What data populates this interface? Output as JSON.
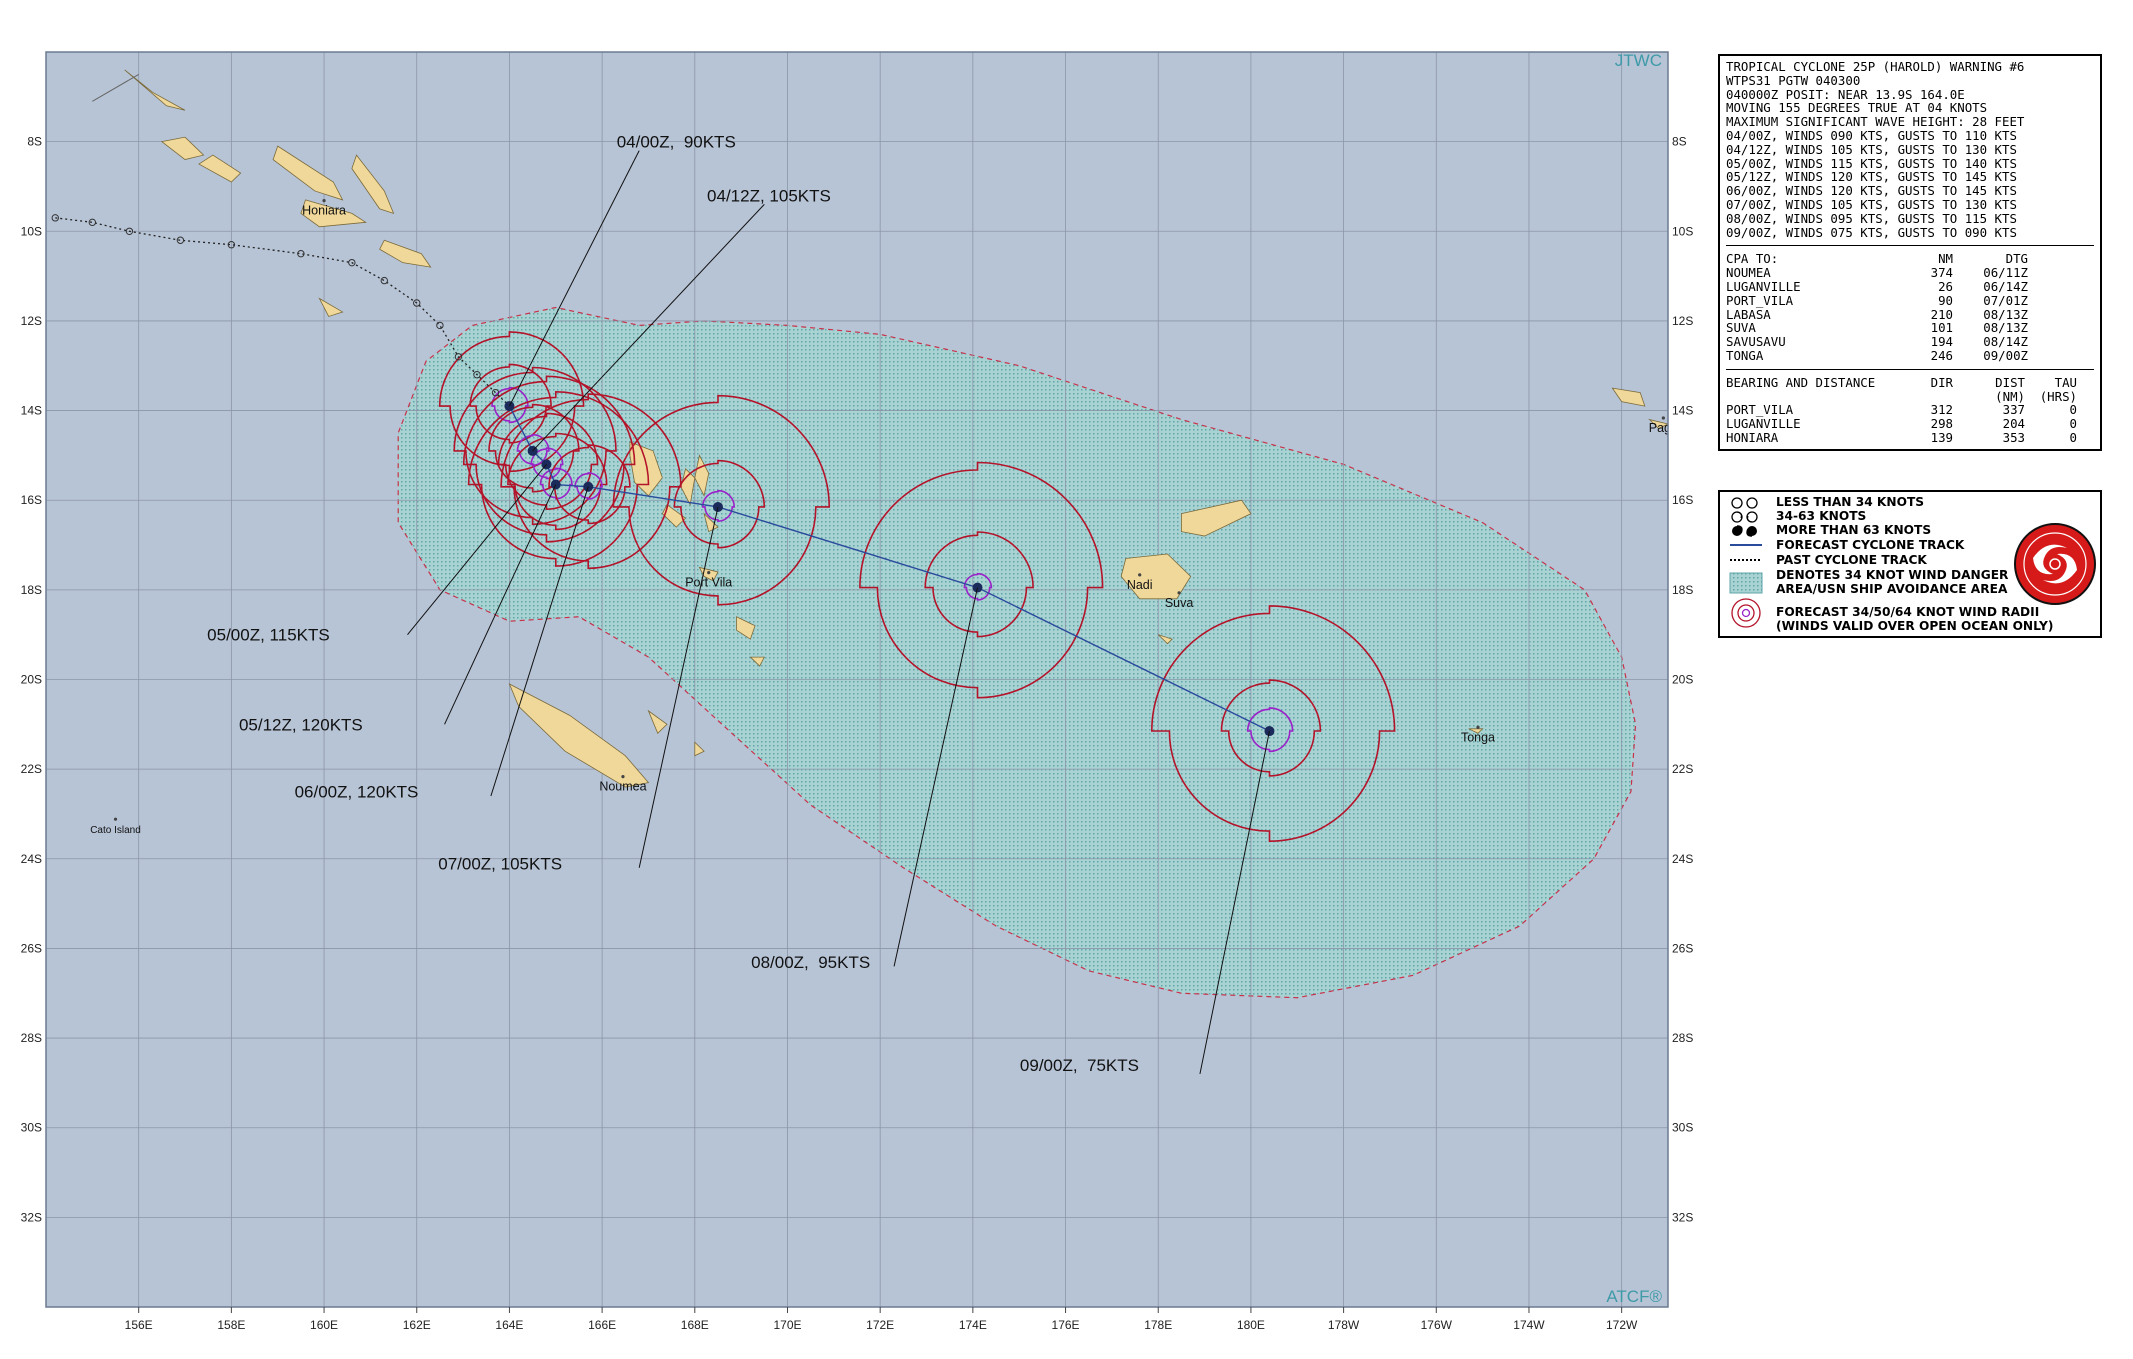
{
  "map": {
    "lon_range": [
      154.0,
      189.0
    ],
    "lat_range": [
      -34.0,
      -6.0
    ],
    "corner_labels": {
      "top_right": "JTWC",
      "bottom_right": "ATCF®"
    },
    "lat_ticks": [
      {
        "lat": -8,
        "label": "8S"
      },
      {
        "lat": -10,
        "label": "10S"
      },
      {
        "lat": -12,
        "label": "12S"
      },
      {
        "lat": -14,
        "label": "14S"
      },
      {
        "lat": -16,
        "label": "16S"
      },
      {
        "lat": -18,
        "label": "18S"
      },
      {
        "lat": -20,
        "label": "20S"
      },
      {
        "lat": -22,
        "label": "22S"
      },
      {
        "lat": -24,
        "label": "24S"
      },
      {
        "lat": -26,
        "label": "26S"
      },
      {
        "lat": -28,
        "label": "28S"
      },
      {
        "lat": -30,
        "label": "30S"
      },
      {
        "lat": -32,
        "label": "32S"
      }
    ],
    "lon_ticks": [
      {
        "lon": 156,
        "label": "156E"
      },
      {
        "lon": 158,
        "label": "158E"
      },
      {
        "lon": 160,
        "label": "160E"
      },
      {
        "lon": 162,
        "label": "162E"
      },
      {
        "lon": 164,
        "label": "164E"
      },
      {
        "lon": 166,
        "label": "166E"
      },
      {
        "lon": 168,
        "label": "168E"
      },
      {
        "lon": 170,
        "label": "170E"
      },
      {
        "lon": 172,
        "label": "172E"
      },
      {
        "lon": 174,
        "label": "174E"
      },
      {
        "lon": 176,
        "label": "176E"
      },
      {
        "lon": 178,
        "label": "178E"
      },
      {
        "lon": 180,
        "label": "180E"
      },
      {
        "lon": 182,
        "label": "178W"
      },
      {
        "lon": 184,
        "label": "176W"
      },
      {
        "lon": 186,
        "label": "174W"
      },
      {
        "lon": 188,
        "label": "172W"
      }
    ],
    "places": [
      {
        "name": "Honiara",
        "lon": 160.0,
        "lat": -9.45
      },
      {
        "name": "Port Vila",
        "lon": 168.3,
        "lat": -17.75
      },
      {
        "name": "Nadi",
        "lon": 177.6,
        "lat": -17.8
      },
      {
        "name": "Suva",
        "lon": 178.45,
        "lat": -18.2
      },
      {
        "name": "Noumea",
        "lon": 166.45,
        "lat": -22.3
      },
      {
        "name": "Cato Island",
        "lon": 155.5,
        "lat": -23.25
      },
      {
        "name": "Tonga",
        "lon": 184.9,
        "lat": -21.2
      },
      {
        "name": "Pago",
        "lon": 188.9,
        "lat": -14.3
      }
    ],
    "past_track": [
      [
        154.2,
        -9.7
      ],
      [
        155.0,
        -9.8
      ],
      [
        155.8,
        -10.0
      ],
      [
        156.9,
        -10.2
      ],
      [
        158.0,
        -10.3
      ],
      [
        159.5,
        -10.5
      ],
      [
        160.6,
        -10.7
      ],
      [
        161.3,
        -11.1
      ],
      [
        162.0,
        -11.6
      ],
      [
        162.5,
        -12.1
      ],
      [
        162.9,
        -12.8
      ],
      [
        163.3,
        -13.2
      ],
      [
        163.7,
        -13.6
      ],
      [
        164.0,
        -13.9
      ]
    ],
    "forecast_track": [
      [
        164.0,
        -13.9
      ],
      [
        164.5,
        -14.9
      ],
      [
        164.8,
        -15.2
      ],
      [
        165.0,
        -15.65
      ],
      [
        165.7,
        -15.7
      ],
      [
        168.5,
        -16.15
      ],
      [
        174.1,
        -17.95
      ],
      [
        180.4,
        -21.15
      ]
    ],
    "forecast_points": [
      {
        "label": "04/00Z,  90KTS",
        "lon": 164.0,
        "lat": -13.9,
        "r34": 1.6,
        "r50": 0.9,
        "r64": 0.4
      },
      {
        "label": "04/12Z, 105KTS",
        "lon": 164.5,
        "lat": -14.9,
        "r34": 1.8,
        "r50": 1.0,
        "r64": 0.35
      },
      {
        "label": "05/00Z, 115KTS",
        "lon": 164.8,
        "lat": -15.2,
        "r34": 1.9,
        "r50": 1.1,
        "r64": 0.35
      },
      {
        "label": "05/12Z, 120KTS",
        "lon": 165.0,
        "lat": -15.65,
        "r34": 2.0,
        "r50": 1.1,
        "r64": 0.35
      },
      {
        "label": "06/00Z, 120KTS",
        "lon": 165.7,
        "lat": -15.7,
        "r34": 2.0,
        "r50": 0.9,
        "r64": 0.3
      },
      {
        "label": "07/00Z, 105KTS",
        "lon": 168.5,
        "lat": -16.15,
        "r34": 2.4,
        "r50": 1.0,
        "r64": 0.35
      },
      {
        "label": "08/00Z,  95KTS",
        "lon": 174.1,
        "lat": -17.95,
        "r34": 2.7,
        "r50": 1.2,
        "r64": 0.3
      },
      {
        "label": "09/00Z,  75KTS",
        "lon": 180.4,
        "lat": -21.15,
        "r34": 2.7,
        "r50": 1.1,
        "r64": 0.5
      }
    ],
    "callouts": [
      {
        "label": "04/00Z,  90KTS",
        "lon": 164.0,
        "lat": -13.9,
        "text_lon": 167.6,
        "text_lat": -8.0,
        "end_lon": 166.8,
        "end_lat": -8.2
      },
      {
        "label": "04/12Z, 105KTS",
        "lon": 164.5,
        "lat": -14.9,
        "text_lon": 169.6,
        "text_lat": -9.2,
        "end_lon": 169.5,
        "end_lat": -9.4
      },
      {
        "label": "05/00Z, 115KTS",
        "lon": 164.8,
        "lat": -15.2,
        "text_lon": 158.8,
        "text_lat": -19.0,
        "end_lon": 161.8,
        "end_lat": -19.0
      },
      {
        "label": "05/12Z, 120KTS",
        "lon": 165.0,
        "lat": -15.65,
        "text_lon": 159.5,
        "text_lat": -21.0,
        "end_lon": 162.6,
        "end_lat": -21.0
      },
      {
        "label": "06/00Z, 120KTS",
        "lon": 165.7,
        "lat": -15.7,
        "text_lon": 160.7,
        "text_lat": -22.5,
        "end_lon": 163.6,
        "end_lat": -22.6
      },
      {
        "label": "07/00Z, 105KTS",
        "lon": 168.5,
        "lat": -16.15,
        "text_lon": 163.8,
        "text_lat": -24.1,
        "end_lon": 166.8,
        "end_lat": -24.2
      },
      {
        "label": "08/00Z,  95KTS",
        "lon": 174.1,
        "lat": -17.95,
        "text_lon": 170.5,
        "text_lat": -26.3,
        "end_lon": 172.3,
        "end_lat": -26.4
      },
      {
        "label": "09/00Z,  75KTS",
        "lon": 180.4,
        "lat": -21.15,
        "text_lon": 176.3,
        "text_lat": -28.6,
        "end_lon": 178.9,
        "end_lat": -28.8
      }
    ],
    "danger_area": [
      [
        163.2,
        -12.1
      ],
      [
        165.0,
        -11.7
      ],
      [
        166.8,
        -12.1
      ],
      [
        168.2,
        -12.0
      ],
      [
        170.0,
        -12.1
      ],
      [
        172.0,
        -12.3
      ],
      [
        175.0,
        -13.0
      ],
      [
        178.5,
        -14.2
      ],
      [
        182.0,
        -15.2
      ],
      [
        185.0,
        -16.5
      ],
      [
        187.2,
        -18.0
      ],
      [
        188.0,
        -19.5
      ],
      [
        188.3,
        -21.0
      ],
      [
        188.2,
        -22.5
      ],
      [
        187.4,
        -24.0
      ],
      [
        185.8,
        -25.5
      ],
      [
        183.5,
        -26.6
      ],
      [
        181.0,
        -27.1
      ],
      [
        178.5,
        -27.0
      ],
      [
        176.5,
        -26.5
      ],
      [
        174.5,
        -25.5
      ],
      [
        172.5,
        -24.2
      ],
      [
        170.5,
        -22.8
      ],
      [
        168.8,
        -21.2
      ],
      [
        167.0,
        -19.5
      ],
      [
        165.5,
        -18.6
      ],
      [
        164.0,
        -18.7
      ],
      [
        162.5,
        -18.0
      ],
      [
        161.6,
        -16.5
      ],
      [
        161.6,
        -14.5
      ],
      [
        162.2,
        -12.9
      ]
    ],
    "colors": {
      "ocean": "#b7c4d6",
      "land": "#f0d89a",
      "grid": "#8b96a8",
      "danger": "#9fcfcf",
      "track": "#2a4a9c",
      "r34": "#b4142a",
      "r50": "#b4142a",
      "r64": "#9a22c8"
    }
  },
  "info_panel": {
    "header": [
      "TROPICAL CYCLONE 25P (HAROLD) WARNING #6",
      "WTPS31 PGTW 040300",
      "040000Z POSIT: NEAR 13.9S 164.0E",
      "MOVING 155 DEGREES TRUE AT 04 KNOTS",
      "MAXIMUM SIGNIFICANT WAVE HEIGHT: 28 FEET",
      "04/00Z, WINDS 090 KTS, GUSTS TO 110 KTS",
      "04/12Z, WINDS 105 KTS, GUSTS TO 130 KTS",
      "05/00Z, WINDS 115 KTS, GUSTS TO 140 KTS",
      "05/12Z, WINDS 120 KTS, GUSTS TO 145 KTS",
      "06/00Z, WINDS 120 KTS, GUSTS TO 145 KTS",
      "07/00Z, WINDS 105 KTS, GUSTS TO 130 KTS",
      "08/00Z, WINDS 095 KTS, GUSTS TO 115 KTS",
      "09/00Z, WINDS 075 KTS, GUSTS TO 090 KTS"
    ],
    "cpa": {
      "title": "CPA TO:",
      "col_nm": "NM",
      "col_dtg": "DTG",
      "rows": [
        {
          "place": "NOUMEA",
          "nm": "374",
          "dtg": "06/11Z"
        },
        {
          "place": "LUGANVILLE",
          "nm": "26",
          "dtg": "06/14Z"
        },
        {
          "place": "PORT_VILA",
          "nm": "90",
          "dtg": "07/01Z"
        },
        {
          "place": "LABASA",
          "nm": "210",
          "dtg": "08/13Z"
        },
        {
          "place": "SUVA",
          "nm": "101",
          "dtg": "08/13Z"
        },
        {
          "place": "SAVUSAVU",
          "nm": "194",
          "dtg": "08/14Z"
        },
        {
          "place": "TONGA",
          "nm": "246",
          "dtg": "09/00Z"
        }
      ]
    },
    "bearing": {
      "title": "BEARING AND DISTANCE",
      "col_dir": "DIR",
      "col_dist": "DIST",
      "col_tau": "TAU",
      "col_dist_unit": "(NM)",
      "col_tau_unit": "(HRS)",
      "rows": [
        {
          "place": "PORT_VILA",
          "dir": "312",
          "dist": "337",
          "tau": "0"
        },
        {
          "place": "LUGANVILLE",
          "dir": "298",
          "dist": "204",
          "tau": "0"
        },
        {
          "place": "HONIARA",
          "dir": "139",
          "dist": "353",
          "tau": "0"
        }
      ]
    }
  },
  "legend": {
    "items": [
      "LESS THAN 34 KNOTS",
      "34-63 KNOTS",
      "MORE THAN 63 KNOTS",
      "FORECAST CYCLONE TRACK",
      "PAST CYCLONE TRACK",
      "DENOTES 34 KNOT WIND DANGER",
      "AREA/USN SHIP AVOIDANCE AREA",
      "FORECAST 34/50/64 KNOT WIND RADII",
      "(WINDS VALID OVER OPEN OCEAN ONLY)"
    ]
  }
}
